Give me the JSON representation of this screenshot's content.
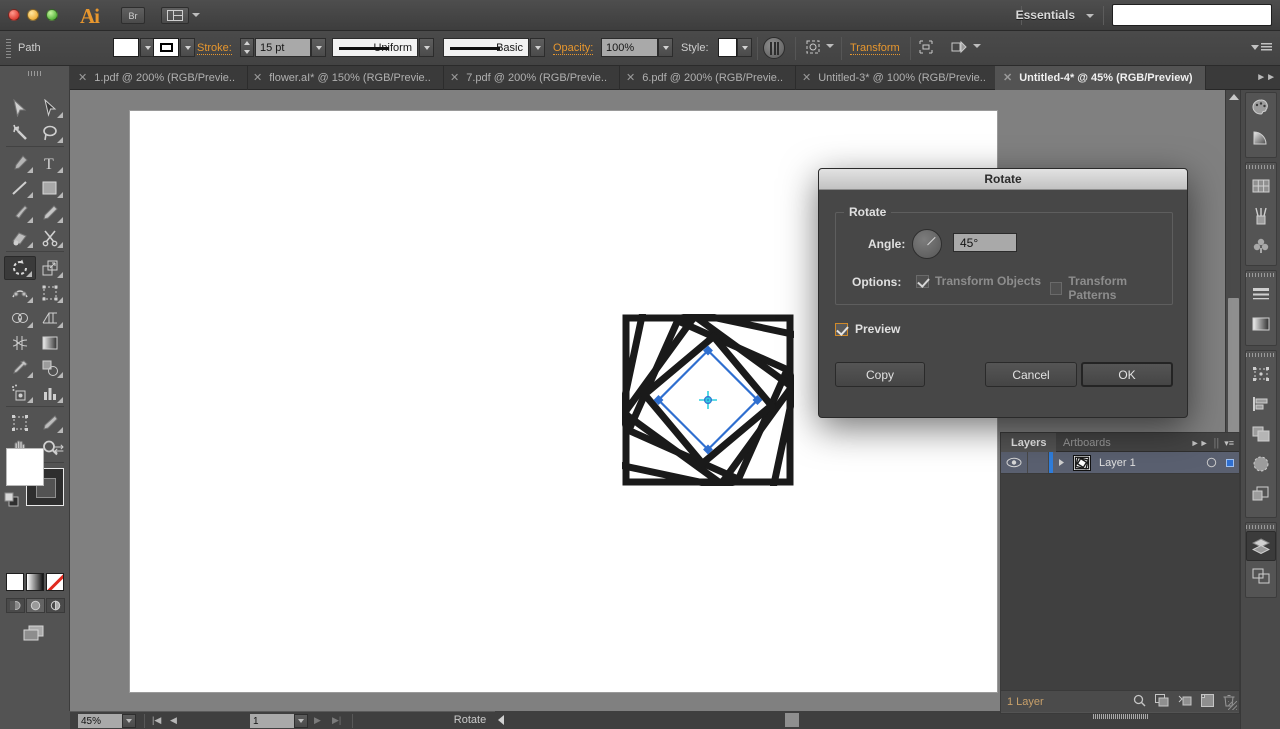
{
  "app": {
    "name": "Ai",
    "workspace": "Essentials",
    "bridge_button": "Br"
  },
  "control_bar": {
    "selection_type": "Path",
    "stroke_label": "Stroke:",
    "stroke_weight": "15 pt",
    "profile_uniform": "Uniform",
    "brush_basic": "Basic",
    "opacity_label": "Opacity:",
    "opacity_value": "100%",
    "style_label": "Style:",
    "transform_label": "Transform"
  },
  "tabs": [
    {
      "label": "1.pdf @ 200% (RGB/Previe..",
      "active": false
    },
    {
      "label": "flower.aI* @ 150% (RGB/Previe..",
      "active": false
    },
    {
      "label": "7.pdf @ 200% (RGB/Previe..",
      "active": false
    },
    {
      "label": "6.pdf @ 200% (RGB/Previe..",
      "active": false
    },
    {
      "label": "Untitled-3* @ 100% (RGB/Previe..",
      "active": false
    },
    {
      "label": "Untitled-4* @ 45% (RGB/Preview)",
      "active": true
    }
  ],
  "tools": [
    "selection-tool",
    "direct-selection-tool",
    "magic-wand-tool",
    "lasso-tool",
    "pen-tool",
    "type-tool",
    "line-segment-tool",
    "rectangle-tool",
    "paintbrush-tool",
    "pencil-tool",
    "blob-brush-tool",
    "scissors-tool",
    "rotate-tool",
    "scale-tool",
    "width-tool",
    "free-transform-tool",
    "shape-builder-tool",
    "perspective-grid-tool",
    "mesh-tool",
    "gradient-tool",
    "eyedropper-tool",
    "blend-tool",
    "symbol-sprayer-tool",
    "column-graph-tool",
    "artboard-tool",
    "slice-tool",
    "hand-tool",
    "zoom-tool"
  ],
  "tool_selected": "rotate-tool",
  "dialog": {
    "title": "Rotate",
    "group_legend": "Rotate",
    "angle_label": "Angle:",
    "angle_value": "45°",
    "options_label": "Options:",
    "transform_objects_label": "Transform Objects",
    "transform_objects_checked": true,
    "transform_patterns_label": "Transform Patterns",
    "transform_patterns_checked": false,
    "preview_label": "Preview",
    "preview_checked": true,
    "copy_button": "Copy",
    "cancel_button": "Cancel",
    "ok_button": "OK"
  },
  "layers_panel": {
    "tab_layers": "Layers",
    "tab_artboards": "Artboards",
    "layer_name": "Layer 1",
    "footer_count": "1 Layer",
    "footer_buttons": [
      "locate-object-icon",
      "make-clipping-mask-icon",
      "create-new-sublayer-icon",
      "create-new-layer-icon",
      "delete-selection-icon"
    ]
  },
  "status_bar": {
    "zoom": "45%",
    "page": "1",
    "status_text": "Rotate"
  },
  "dock_icons": [
    "color-panel-icon",
    "color-guide-icon",
    "swatches-panel-icon",
    "brushes-panel-icon",
    "symbols-panel-icon",
    "stroke-panel-icon",
    "gradient-panel-icon",
    "transform-panel-icon",
    "align-panel-icon",
    "pathfinder-panel-icon",
    "transparency-panel-icon",
    "appearance-panel-icon",
    "layers-panel-icon",
    "artboards-panel-icon"
  ],
  "colors": {
    "accent_orange": "#e8972e",
    "selection_blue": "#2f6fd0",
    "panel_bg": "#535353",
    "canvas_bg": "#808080",
    "artboard_bg": "#ffffff",
    "artwork_stroke": "#1a1a1a"
  },
  "artwork": {
    "description": "nested-rotated-squares-spiral",
    "selected_path_angle_deg": 45,
    "stroke_color": "#1a1a1a",
    "selection_color": "#2f6fd0"
  }
}
